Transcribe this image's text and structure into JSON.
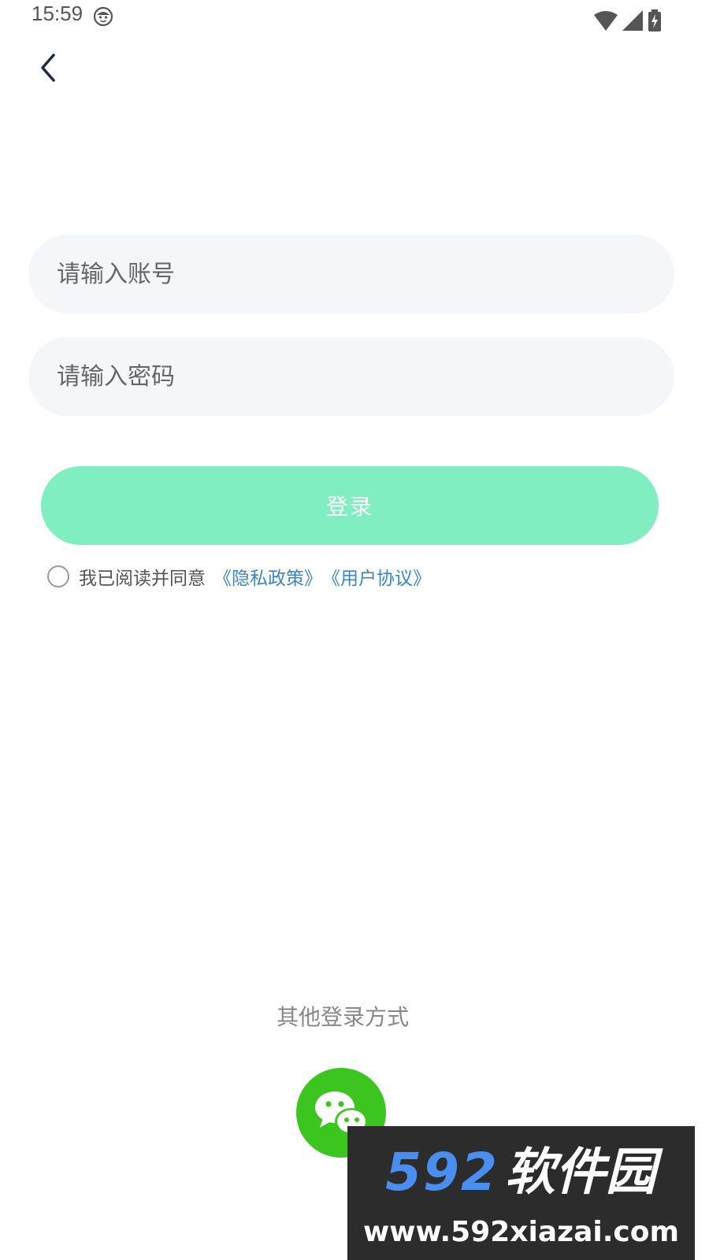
{
  "status_bar": {
    "time": "15:59",
    "icons": [
      "face-icon",
      "wifi-icon",
      "signal-icon",
      "battery-charging-icon"
    ]
  },
  "nav": {
    "back_icon": "chevron-left-icon"
  },
  "form": {
    "account": {
      "placeholder": "请输入账号",
      "value": ""
    },
    "password": {
      "placeholder": "请输入密码",
      "value": ""
    },
    "login_label": "登录"
  },
  "agreement": {
    "checked": false,
    "text": "我已阅读并同意",
    "privacy_link": "《隐私政策》",
    "user_link": "《用户协议》"
  },
  "other_login": {
    "title": "其他登录方式",
    "wechat_icon": "wechat-icon"
  },
  "watermark": {
    "brand_number": "592",
    "brand_text": "软件园",
    "url": "www.592xiazai.com"
  },
  "colors": {
    "login_button": "#80eec0",
    "link": "#3a86c8",
    "wechat": "#3cc51f",
    "field_bg": "#f5f6fa",
    "watermark_bg": "#2c2c2c"
  }
}
